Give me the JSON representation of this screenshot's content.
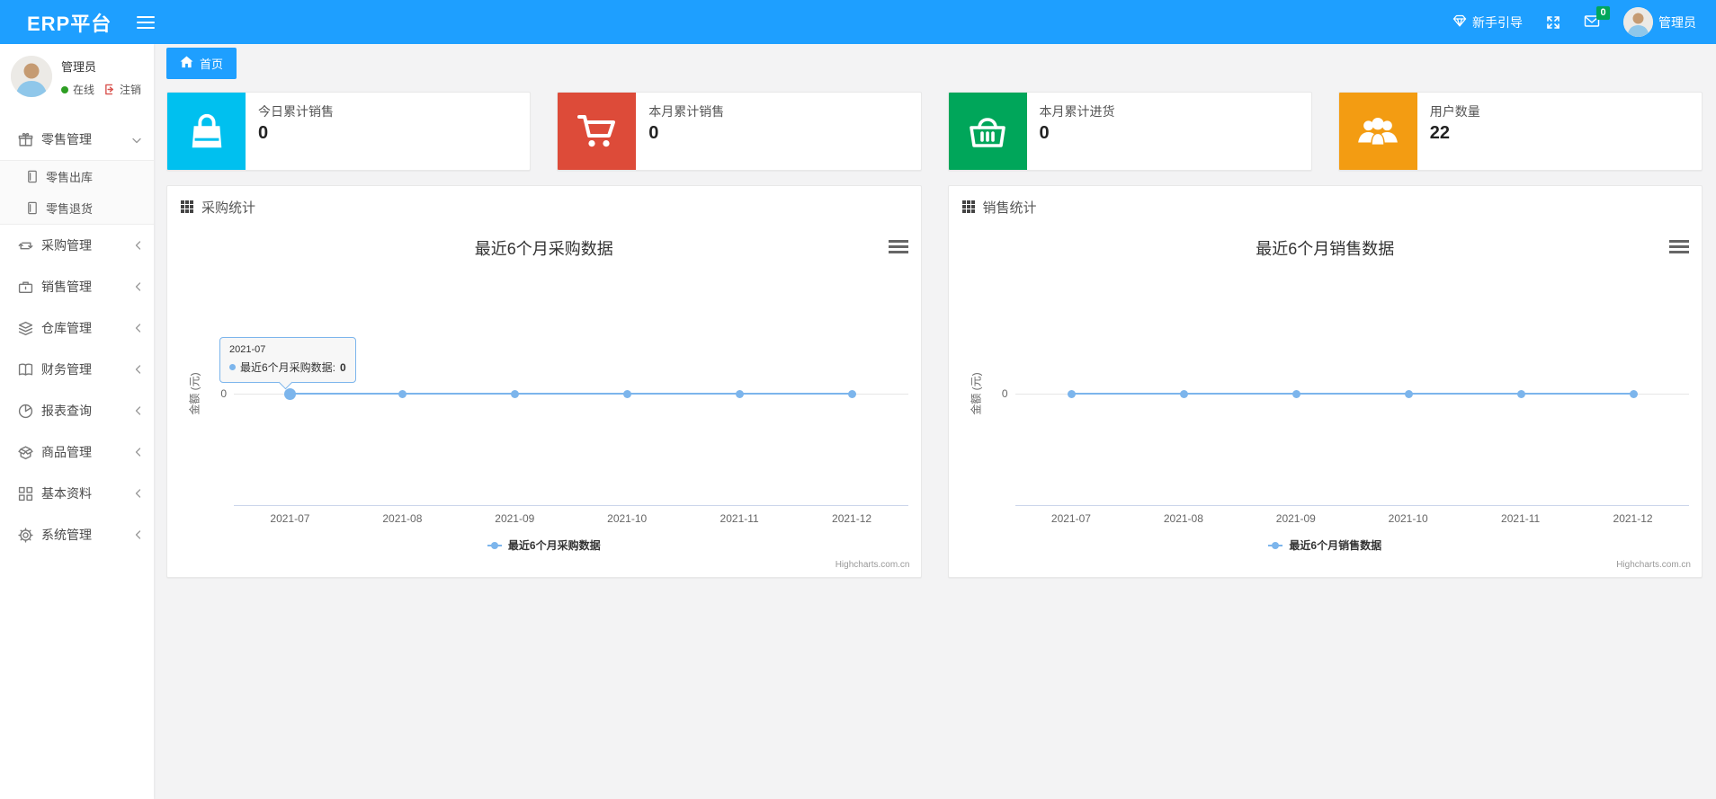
{
  "theme": {
    "accent": "#1e9fff",
    "line_color": "#7cb5ec",
    "badge_green": "#00a65a"
  },
  "navbar": {
    "brand": "ERP平台",
    "guide_label": "新手引导",
    "mail_badge": "0",
    "username": "管理员"
  },
  "sidebar": {
    "username": "管理员",
    "online_label": "在线",
    "logout_label": "注销",
    "menu": [
      {
        "label": "零售管理",
        "icon": "gift-icon",
        "expanded": true,
        "children": [
          {
            "label": "零售出库",
            "icon": "journal-icon"
          },
          {
            "label": "零售退货",
            "icon": "journal-icon"
          }
        ]
      },
      {
        "label": "采购管理",
        "icon": "loop-icon"
      },
      {
        "label": "销售管理",
        "icon": "briefcase-icon"
      },
      {
        "label": "仓库管理",
        "icon": "layers-icon"
      },
      {
        "label": "财务管理",
        "icon": "book-icon"
      },
      {
        "label": "报表查询",
        "icon": "pie-chart-icon"
      },
      {
        "label": "商品管理",
        "icon": "box-icon"
      },
      {
        "label": "基本资料",
        "icon": "grid-icon"
      },
      {
        "label": "系统管理",
        "icon": "gear-icon"
      }
    ]
  },
  "breadcrumb": {
    "home": "首页"
  },
  "cards": [
    {
      "title": "今日累计销售",
      "value": "0",
      "color": "#00c0ef",
      "icon": "shopping-bag-icon"
    },
    {
      "title": "本月累计销售",
      "value": "0",
      "color": "#dd4b39",
      "icon": "cart-icon"
    },
    {
      "title": "本月累计进货",
      "value": "0",
      "color": "#00a65a",
      "icon": "basket-icon"
    },
    {
      "title": "用户数量",
      "value": "22",
      "color": "#f39c12",
      "icon": "users-icon"
    }
  ],
  "chart_data": [
    {
      "type": "line",
      "panel_title": "采购统计",
      "title": "最近6个月采购数据",
      "categories": [
        "2021-07",
        "2021-08",
        "2021-09",
        "2021-10",
        "2021-11",
        "2021-12"
      ],
      "series": [
        {
          "name": "最近6个月采购数据",
          "values": [
            0,
            0,
            0,
            0,
            0,
            0
          ]
        }
      ],
      "xlabel": "",
      "ylabel": "金额 (元)",
      "yticks": [
        "0"
      ],
      "ylim": [
        0,
        1
      ],
      "grid": false,
      "legend_position": "bottom",
      "credits": "Highcharts.com.cn",
      "tooltip": {
        "visible": true,
        "x_label": "2021-07",
        "series_label": "最近6个月采购数据:",
        "value": "0"
      }
    },
    {
      "type": "line",
      "panel_title": "销售统计",
      "title": "最近6个月销售数据",
      "categories": [
        "2021-07",
        "2021-08",
        "2021-09",
        "2021-10",
        "2021-11",
        "2021-12"
      ],
      "series": [
        {
          "name": "最近6个月销售数据",
          "values": [
            0,
            0,
            0,
            0,
            0,
            0
          ]
        }
      ],
      "xlabel": "",
      "ylabel": "金额 (元)",
      "yticks": [
        "0"
      ],
      "ylim": [
        0,
        1
      ],
      "grid": false,
      "legend_position": "bottom",
      "credits": "Highcharts.com.cn",
      "tooltip": {
        "visible": false
      }
    }
  ]
}
